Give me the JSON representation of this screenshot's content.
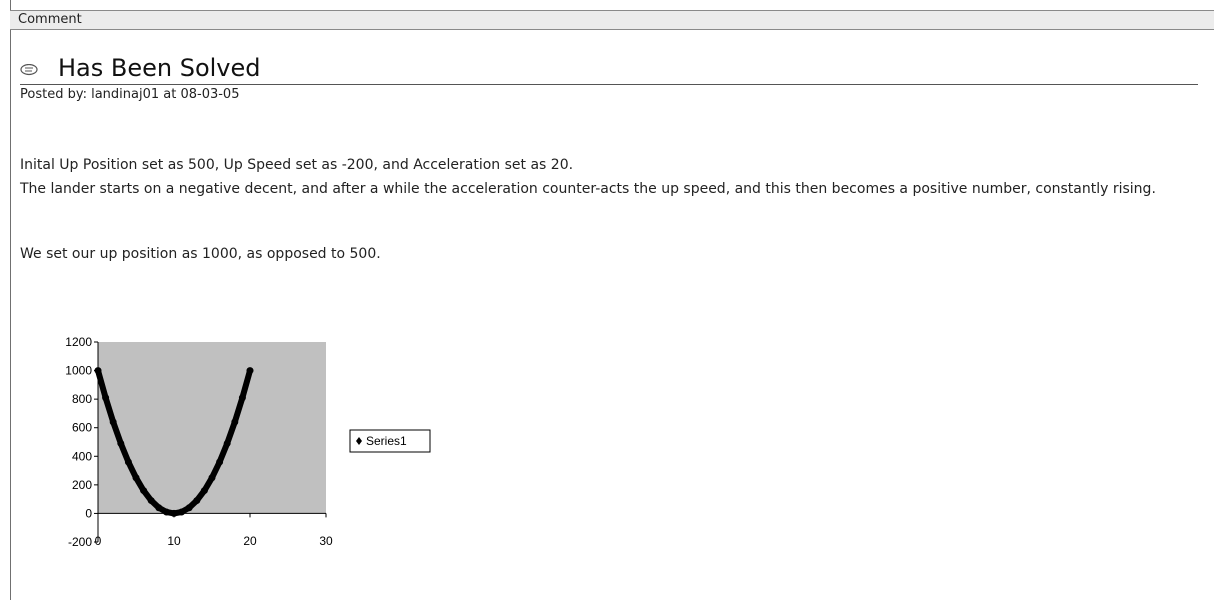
{
  "header": {
    "label": "Comment"
  },
  "post": {
    "icon": "comment-bubble-icon",
    "title": "Has Been Solved",
    "posted_by": "Posted by: landinaj01 at 08-03-05",
    "paragraphs": [
      "Inital Up Position set as 500, Up Speed set as -200, and Acceleration set as 20.",
      "The lander starts on a negative decent, and after a while the acceleration counter-acts the up speed, and this then becomes a positive number, constantly rising.",
      "We set our up position as 1000, as opposed to 500."
    ]
  },
  "chart_data": {
    "type": "scatter",
    "x": [
      0,
      1,
      2,
      3,
      4,
      5,
      6,
      7,
      8,
      9,
      10,
      11,
      12,
      13,
      14,
      15,
      16,
      17,
      18,
      19,
      20
    ],
    "series": [
      {
        "name": "Series1",
        "values": [
          1000,
          810,
          640,
          490,
          360,
          250,
          160,
          90,
          40,
          10,
          0,
          10,
          40,
          90,
          160,
          250,
          360,
          490,
          640,
          810,
          1000
        ]
      }
    ],
    "xlim": [
      0,
      30
    ],
    "ylim": [
      -200,
      1200
    ],
    "xticks": [
      "0",
      "10",
      "20",
      "30"
    ],
    "yticks": [
      "-200",
      "0",
      "200",
      "400",
      "600",
      "800",
      "1000",
      "1200"
    ],
    "legend": "right",
    "plot_background": "#c0c0c0",
    "marker_color": "#000000",
    "grid": false
  }
}
